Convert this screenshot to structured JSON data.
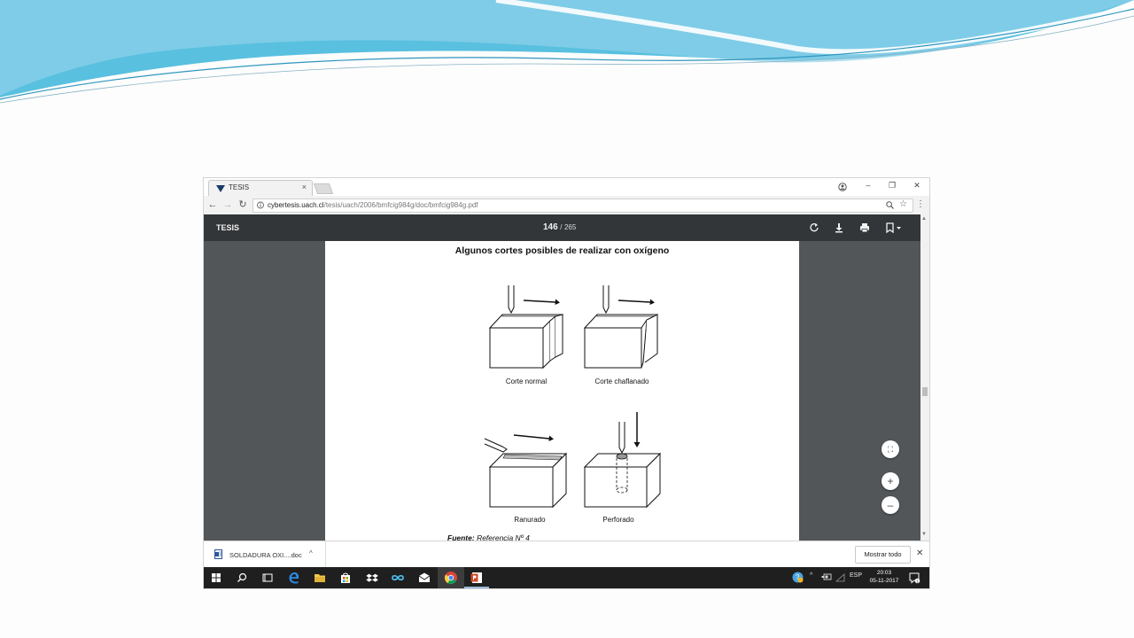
{
  "browser": {
    "tab_title": "TESIS",
    "tab_close": "×",
    "url_host": "cybertesis.uach.cl",
    "url_path": "/tesis/uach/2006/bmfcig984g/doc/bmfcig984g.pdf",
    "window_controls": {
      "minimize": "–",
      "restore": "❐",
      "close": "✕"
    },
    "nav": {
      "back": "←",
      "forward": "→",
      "reload": "↻"
    }
  },
  "pdf": {
    "title": "TESIS",
    "current_page": "146",
    "separator": "/",
    "total_pages": "265",
    "page_title": "Algunos cortes posibles de realizar con oxígeno",
    "figures": [
      {
        "label": "Corte normal"
      },
      {
        "label": "Corte chaflanado"
      },
      {
        "label": "Ranurado"
      },
      {
        "label": "Perforado"
      }
    ],
    "source_label": "Fuente:",
    "source_text": " Referencia Nº 4",
    "zoom_in": "+",
    "zoom_out": "–",
    "fit": "⛶"
  },
  "downloads": {
    "file_name": "SOLDADURA OXI....doc",
    "chevron": "^",
    "show_all": "Mostrar todo",
    "close": "✕"
  },
  "taskbar": {
    "lang": "ESP",
    "time": "20:03",
    "date": "05-11-2017"
  },
  "colors": {
    "wave_dark": "#41b1d6",
    "wave_light": "#a9dbed",
    "pdf_toolbar": "#323639",
    "pdf_bg": "#525659",
    "taskbar": "#1f1f1f"
  }
}
